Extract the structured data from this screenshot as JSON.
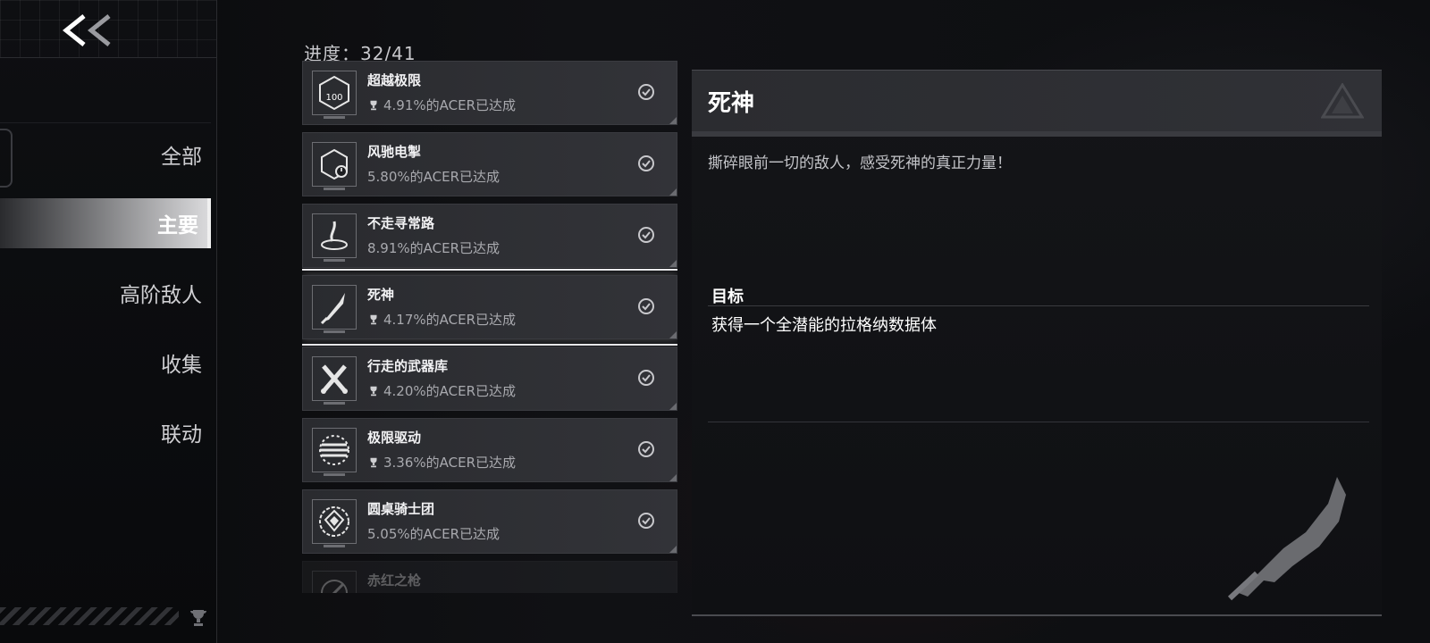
{
  "header": {
    "back_label": "<<",
    "progress_text": "进度：32/41"
  },
  "sidebar": {
    "items": [
      {
        "label": "全部",
        "active": false
      },
      {
        "label": "主要",
        "active": true
      },
      {
        "label": "高阶敌人",
        "active": false
      },
      {
        "label": "收集",
        "active": false
      },
      {
        "label": "联动",
        "active": false
      }
    ]
  },
  "achievements": [
    {
      "name": "超越极限",
      "rate": "4.91%的ACER已达成",
      "trophy": true,
      "icon": "hundred-badge-icon",
      "completed": true
    },
    {
      "name": "风驰电掣",
      "rate": "5.80%的ACER已达成",
      "trophy": false,
      "icon": "speed-clock-icon",
      "completed": true
    },
    {
      "name": "不走寻常路",
      "rate": "8.91%的ACER已达成",
      "trophy": false,
      "icon": "spiral-path-icon",
      "completed": true
    },
    {
      "name": "死神",
      "rate": "4.17%的ACER已达成",
      "trophy": true,
      "icon": "scythe-icon",
      "completed": true,
      "selected": true
    },
    {
      "name": "行走的武器库",
      "rate": "4.20%的ACER已达成",
      "trophy": true,
      "icon": "crossed-guns-icon",
      "completed": true
    },
    {
      "name": "极限驱动",
      "rate": "3.36%的ACER已达成",
      "trophy": true,
      "icon": "drive-lines-icon",
      "completed": true
    },
    {
      "name": "圆桌骑士团",
      "rate": "5.05%的ACER已达成",
      "trophy": false,
      "icon": "knight-emblem-icon",
      "completed": true
    },
    {
      "name": "赤红之枪",
      "rate": "",
      "trophy": false,
      "icon": "spear-icon",
      "completed": false
    }
  ],
  "detail": {
    "title": "死神",
    "description": "撕碎眼前一切的敌人，感受死神的真正力量！",
    "goal_label": "目标",
    "goal_text": "获得一个全潜能的拉格纳数据体"
  },
  "colors": {
    "accent": "#e8e8ea",
    "panel": "#2b2c30",
    "muted_text": "#a8a9ae"
  }
}
